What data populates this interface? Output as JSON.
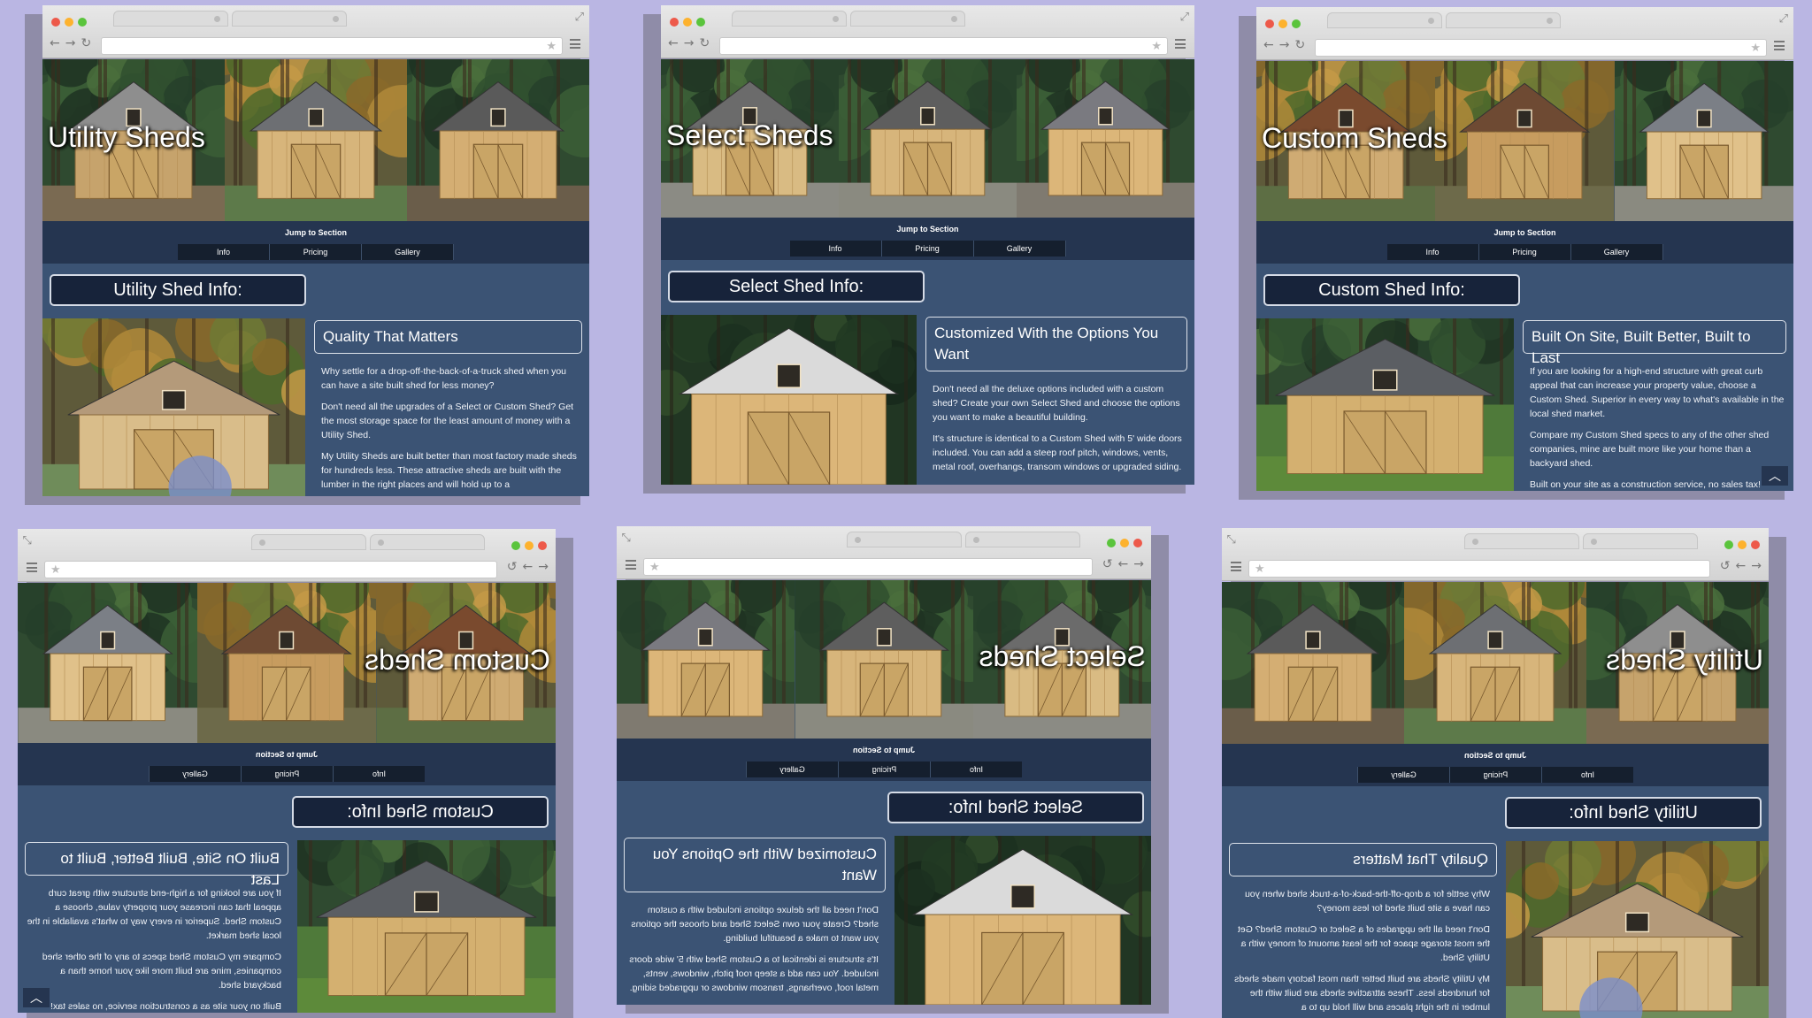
{
  "colors": {
    "background": "#bab6e3",
    "page": "#3b5374",
    "jump_bar": "#253550",
    "info_box": "#17233a",
    "close_dot": "#ed594a",
    "minimize_dot": "#fdb22e",
    "maximize_dot": "#5ac43c"
  },
  "icons": [
    "back-arrow-icon",
    "forward-arrow-icon",
    "reload-icon",
    "bookmark-star-icon",
    "menu-icon",
    "resize-icon",
    "scroll-top-chevron-icon"
  ],
  "nav": {
    "jump_label": "Jump to Section",
    "info": "Info",
    "pricing": "Pricing",
    "gallery": "Gallery",
    "scroll_top": "︿"
  },
  "utility": {
    "hero_title": "Utility Sheds",
    "info_heading": "Utility Shed Info:",
    "sub_heading": "Quality That Matters",
    "p1": "Why settle for a drop-off-the-back-of-a-truck shed when you can have a site built shed for less money?",
    "p2": "Don't need all the upgrades of a Select or Custom Shed? Get the most storage space for the least amount of money with a Utility Shed.",
    "p3": "My Utility Sheds are built better than most factory made sheds for hundreds less. These attractive sheds are built with the lumber in the right places and will hold up to a"
  },
  "select": {
    "hero_title": "Select Sheds",
    "info_heading": "Select Shed Info:",
    "sub_heading": "Customized With the Options You Want",
    "p1": "Don't need all the deluxe options included with a custom shed? Create your own Select Shed and choose the options you want to make a beautiful building.",
    "p2": "It's structure is identical to a Custom Shed with 5' wide doors included. You can add a steep roof pitch, windows, vents, metal roof, overhangs, transom windows or upgraded siding."
  },
  "custom": {
    "hero_title": "Custom Sheds",
    "info_heading": "Custom Shed Info:",
    "sub_heading": "Built On Site, Built Better, Built to Last",
    "p1": "If you are looking for a high-end structure with great curb appeal that can increase your property value, choose a Custom Shed. Superior in every way to what's available in the local shed market.",
    "p2": "Compare my Custom Shed specs to any of the other shed companies, mine are built more like your home than a backyard shed.",
    "p3": "Built on your site as a construction service, no sales tax!"
  }
}
